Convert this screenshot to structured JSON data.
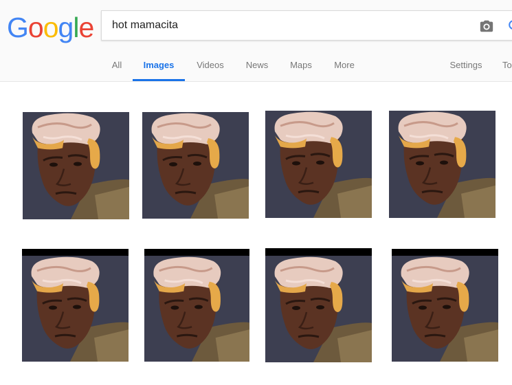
{
  "logo": {
    "letters": [
      "G",
      "o",
      "o",
      "g",
      "l",
      "e"
    ],
    "colors": [
      "#4285f4",
      "#ea4335",
      "#fbbc05",
      "#4285f4",
      "#34a853",
      "#ea4335"
    ]
  },
  "search": {
    "query": "hot mamacita"
  },
  "tabs": [
    {
      "label": "All"
    },
    {
      "label": "Images",
      "active": true
    },
    {
      "label": "Videos"
    },
    {
      "label": "News"
    },
    {
      "label": "Maps"
    },
    {
      "label": "More"
    },
    {
      "label": "Settings"
    },
    {
      "label": "To"
    }
  ],
  "colors": {
    "accent": "#1a73e8"
  },
  "icons": {
    "camera": "camera-icon",
    "search": "search-icon"
  },
  "results": {
    "rows": 2,
    "per_row": 4
  }
}
